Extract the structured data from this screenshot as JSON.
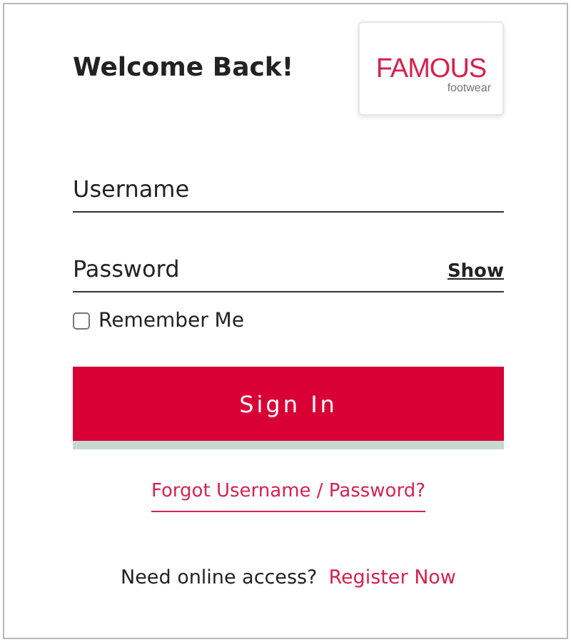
{
  "heading": "Welcome Back!",
  "logo": {
    "brand": "FAMOUS",
    "sub": "footwear"
  },
  "fields": [
    {
      "placeholder": "Username"
    },
    {
      "placeholder": "Password",
      "toggle": "Show"
    }
  ],
  "remember": {
    "label": "Remember Me",
    "checked": false
  },
  "submit": "Sign In",
  "forgot_link": "Forgot Username / Password?",
  "register": {
    "prompt": "Need online access?",
    "link": "Register Now"
  }
}
